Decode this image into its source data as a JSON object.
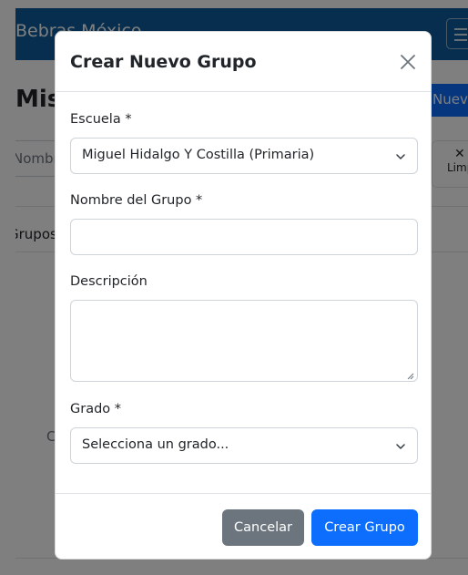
{
  "background": {
    "brand": "Bebras México",
    "page_title": "Mis Grupos",
    "new_group_button": "Nuevo Grupo",
    "search_placeholder": "Nombre",
    "clear_button": "Limpiar",
    "tab_label": "Grupos",
    "placeholder_fragment": "C"
  },
  "modal": {
    "title": "Crear Nuevo Grupo",
    "close_icon": "close-icon",
    "fields": {
      "school": {
        "label": "Escuela *",
        "value": "Miguel Hidalgo Y Costilla (Primaria)"
      },
      "group_name": {
        "label": "Nombre del Grupo *",
        "value": "",
        "placeholder": ""
      },
      "description": {
        "label": "Descripción",
        "value": "",
        "placeholder": ""
      },
      "grade": {
        "label": "Grado *",
        "value": "Selecciona un grado..."
      }
    },
    "buttons": {
      "cancel": "Cancelar",
      "create": "Crear Grupo"
    }
  },
  "colors": {
    "navbar": "#0f5d9c",
    "primary": "#0d6efd",
    "secondary": "#6c757d",
    "backdrop": "rgba(0,0,0,0.5)"
  }
}
